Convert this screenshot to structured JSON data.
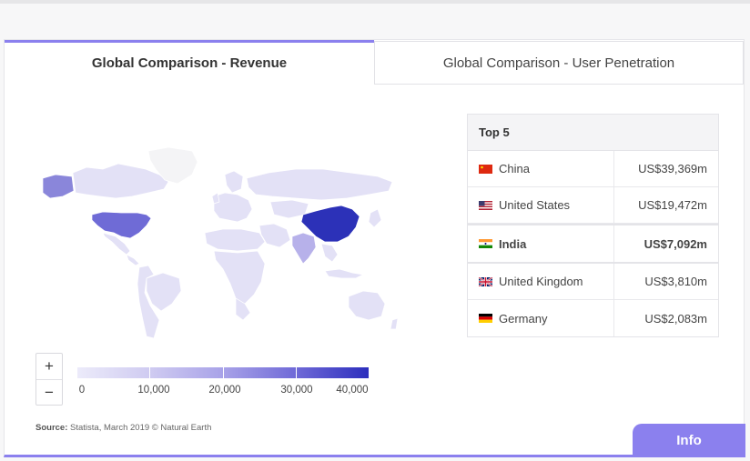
{
  "tabs": [
    {
      "label": "Global Comparison - Revenue",
      "active": true
    },
    {
      "label": "Global Comparison - User Penetration",
      "active": false
    }
  ],
  "top5": {
    "header": "Top 5",
    "rows": [
      {
        "country": "China",
        "value": "US$39,369m",
        "flag": "china-flag-icon"
      },
      {
        "country": "United States",
        "value": "US$19,472m",
        "flag": "us-flag-icon"
      },
      {
        "country": "India",
        "value": "US$7,092m",
        "flag": "india-flag-icon",
        "highlight": true
      },
      {
        "country": "United Kingdom",
        "value": "US$3,810m",
        "flag": "uk-flag-icon"
      },
      {
        "country": "Germany",
        "value": "US$2,083m",
        "flag": "germany-flag-icon"
      }
    ]
  },
  "legend": {
    "ticks": [
      "0",
      "10,000",
      "20,000",
      "30,000",
      "40,000"
    ],
    "colors": [
      "#e4e1f7",
      "#b9b3ed",
      "#8d86e0",
      "#5b55cf",
      "#2c2ebd"
    ]
  },
  "zoom": {
    "in": "+",
    "out": "−"
  },
  "source": {
    "label": "Source:",
    "text": " Statista, March 2019 © Natural Earth"
  },
  "info_button": "Info",
  "colors": {
    "accent": "#8b80ee",
    "china": "#2c31b8",
    "us": "#6f6bd6",
    "default_country": "#e4e2f6"
  }
}
